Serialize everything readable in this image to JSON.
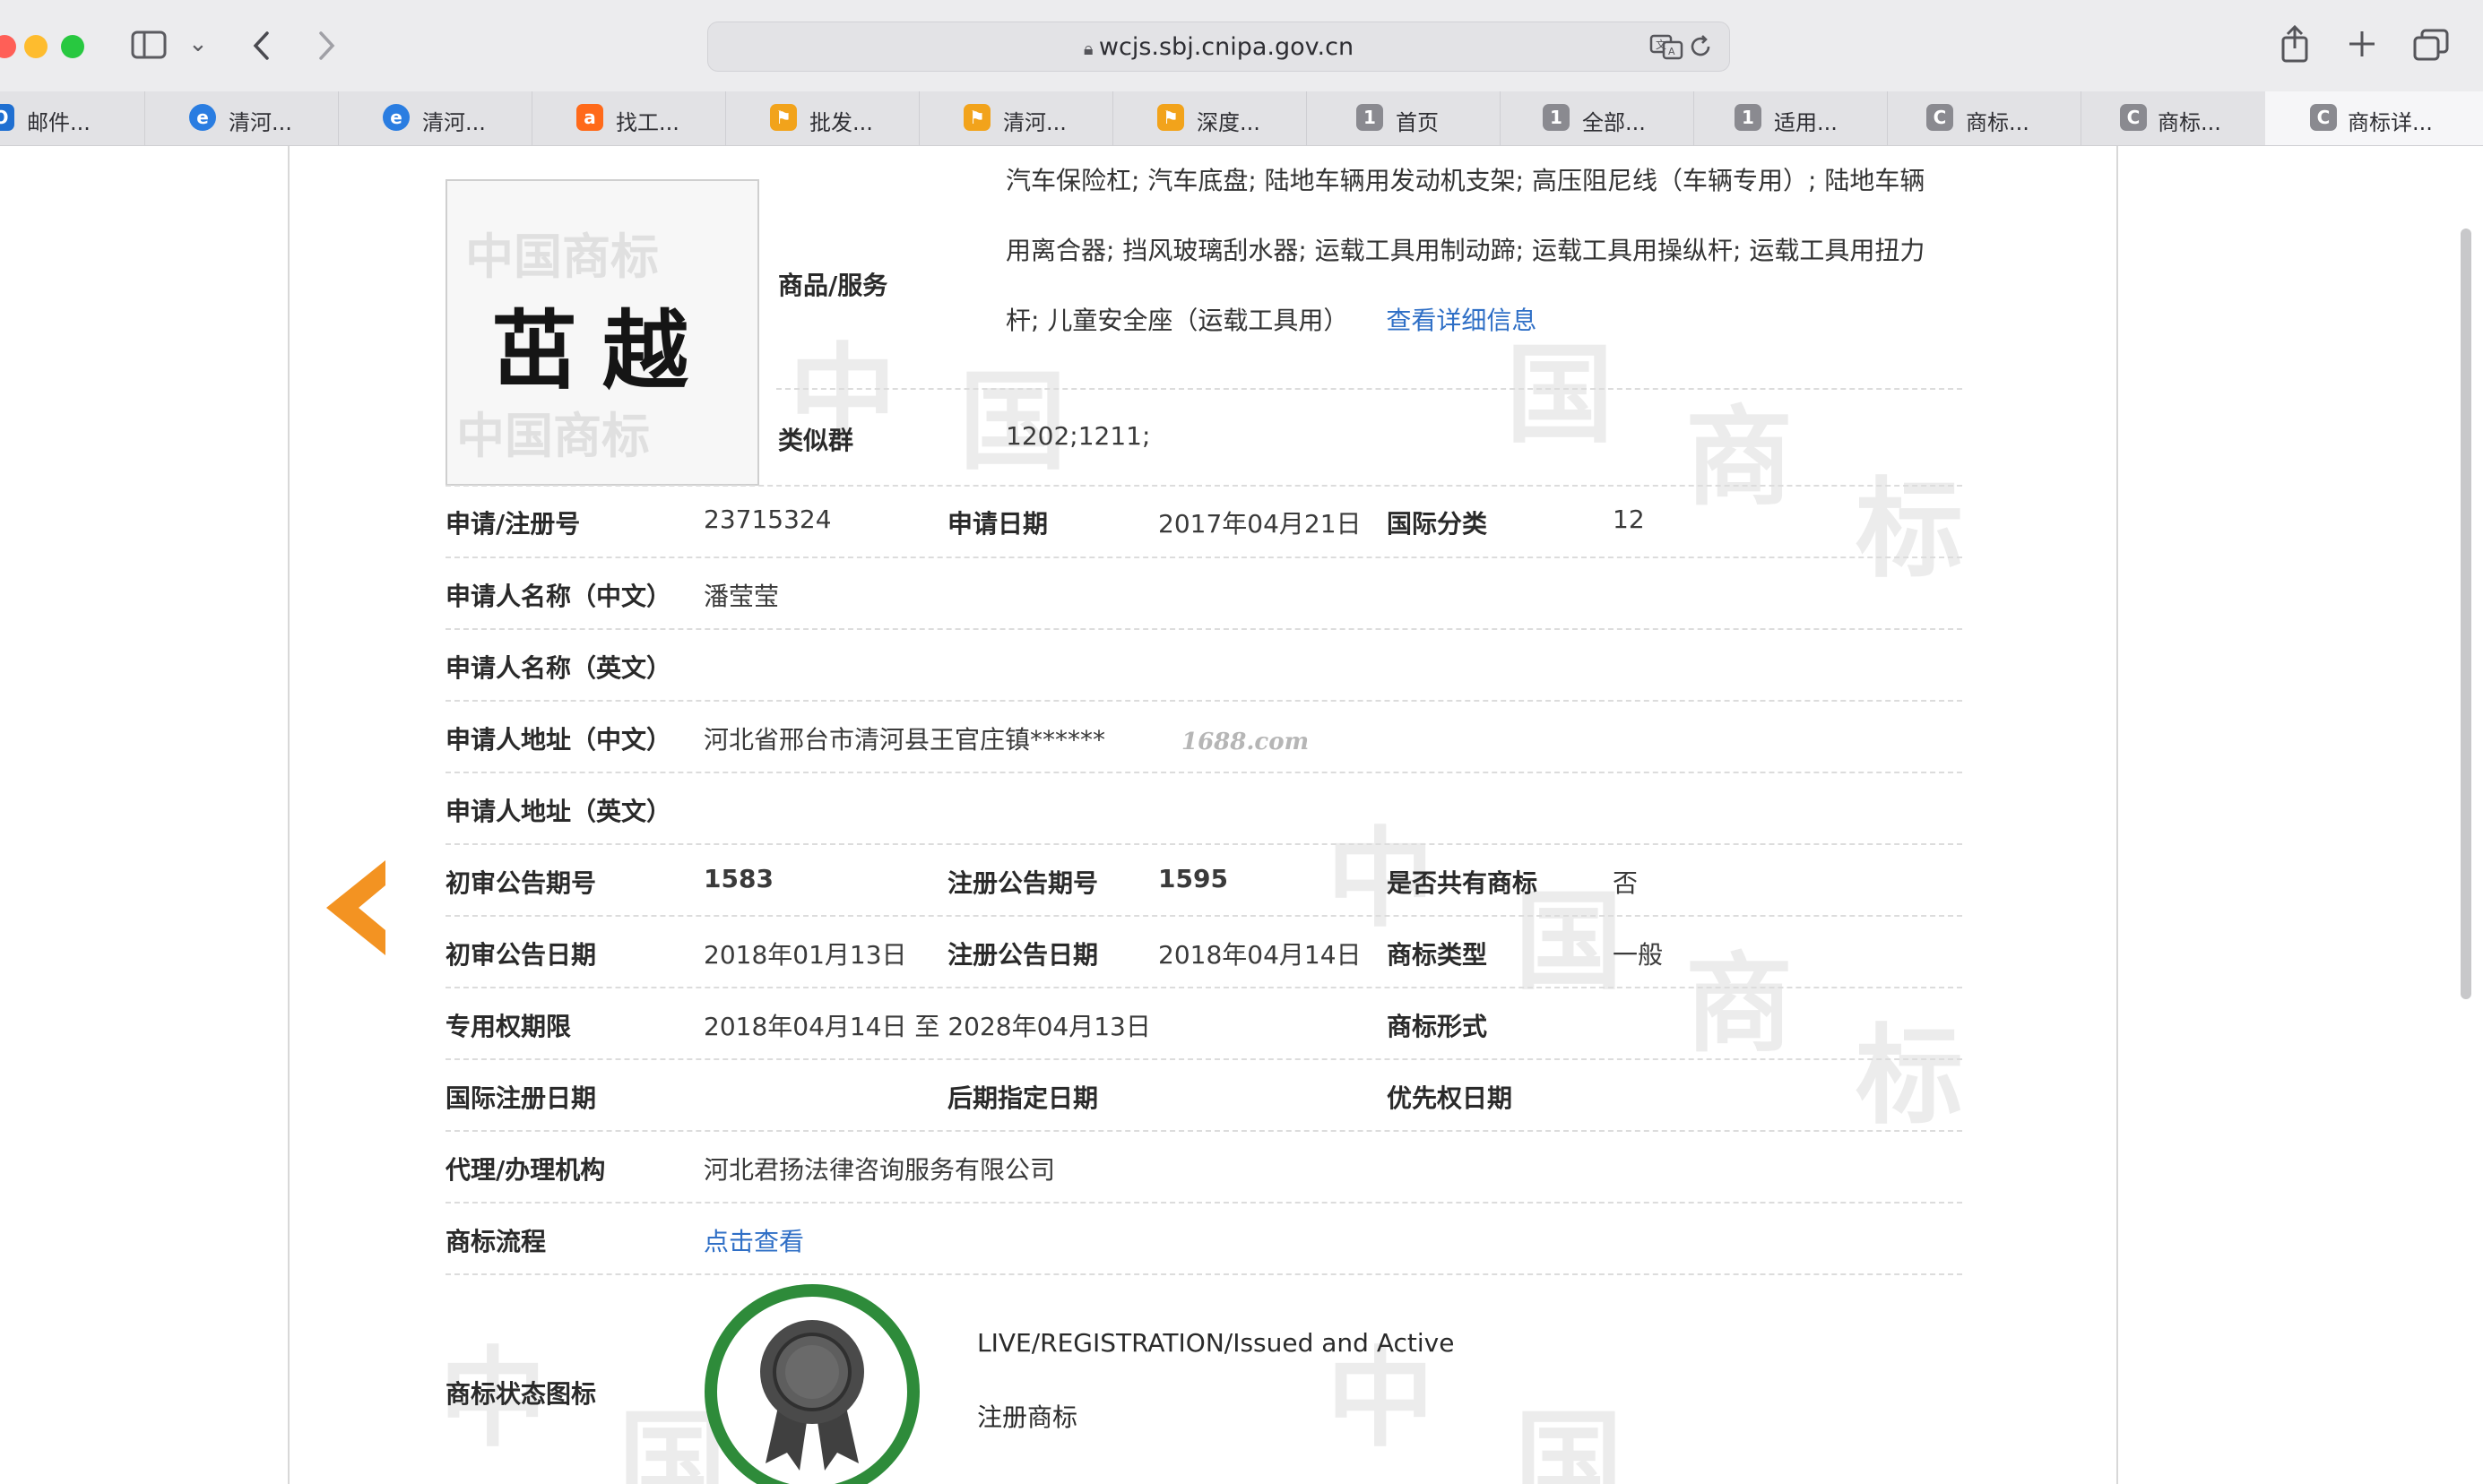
{
  "browser": {
    "url": "wcjs.sbj.cnipa.gov.cn",
    "tabs": [
      {
        "label": "邮件..."
      },
      {
        "label": "清河..."
      },
      {
        "label": "清河..."
      },
      {
        "label": "找工..."
      },
      {
        "label": "批发..."
      },
      {
        "label": "清河..."
      },
      {
        "label": "深度..."
      },
      {
        "label": "首页",
        "favicon_text": "1"
      },
      {
        "label": "全部...",
        "favicon_text": "1"
      },
      {
        "label": "适用...",
        "favicon_text": "1"
      },
      {
        "label": "商标...",
        "favicon_text": "C"
      },
      {
        "label": "商标...",
        "favicon_text": "C"
      },
      {
        "label": "商标详...",
        "favicon_text": "C"
      }
    ]
  },
  "trademark": {
    "image_text": "茁越",
    "goods_label": "商品/服务",
    "goods_lines": [
      "汽车保险杠; 汽车底盘; 陆地车辆用发动机支架; 高压阻尼线（车辆专用）; 陆地车辆",
      "用离合器; 挡风玻璃刮水器; 运载工具用制动蹄; 运载工具用操纵杆; 运载工具用扭力",
      "杆; 儿童安全座（运载工具用）"
    ],
    "goods_detail_link": "查看详细信息",
    "similar_group_label": "类似群",
    "similar_group_value": "1202;1211;",
    "reg_no_label": "申请/注册号",
    "reg_no_value": "23715324",
    "apply_date_label": "申请日期",
    "apply_date_value": "2017年04月21日",
    "intl_class_label": "国际分类",
    "intl_class_value": "12",
    "applicant_cn_label": "申请人名称（中文）",
    "applicant_cn_value": "潘莹莹",
    "applicant_en_label": "申请人名称（英文）",
    "address_cn_label": "申请人地址（中文）",
    "address_cn_value": "河北省邢台市清河县王官庄镇******",
    "address_cn_watermark": "1688.com",
    "address_en_label": "申请人地址（英文）",
    "prelim_no_label": "初审公告期号",
    "prelim_no_value": "1583",
    "reg_pub_no_label": "注册公告期号",
    "reg_pub_no_value": "1595",
    "shared_label": "是否共有商标",
    "shared_value": "否",
    "prelim_date_label": "初审公告日期",
    "prelim_date_value": "2018年01月13日",
    "reg_pub_date_label": "注册公告日期",
    "reg_pub_date_value": "2018年04月14日",
    "tm_type_label": "商标类型",
    "tm_type_value": "一般",
    "term_label": "专用权期限",
    "term_value": "2018年04月14日 至 2028年04月13日",
    "tm_form_label": "商标形式",
    "intl_reg_date_label": "国际注册日期",
    "later_date_label": "后期指定日期",
    "priority_date_label": "优先权日期",
    "agency_label": "代理/办理机构",
    "agency_value": "河北君扬法律咨询服务有限公司",
    "process_label": "商标流程",
    "process_link": "点击查看",
    "status_icon_label": "商标状态图标",
    "status_en": "LIVE/REGISTRATION/Issued and Active",
    "status_cn": "注册商标"
  },
  "colors": {
    "link": "#2f6fc6",
    "back_arrow": "#f39322",
    "status_ring": "#2e8b3a"
  }
}
